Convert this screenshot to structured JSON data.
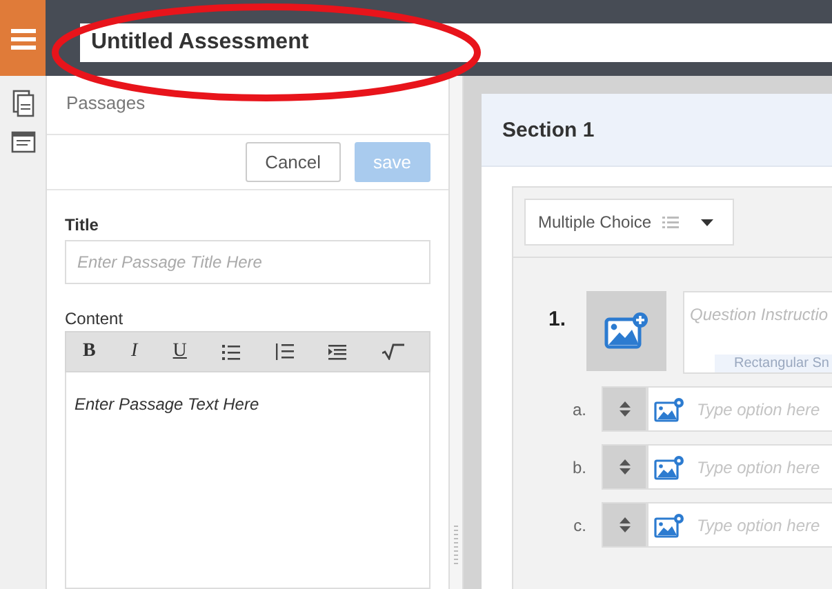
{
  "header": {
    "title": "Untitled Assessment"
  },
  "passages_panel": {
    "heading": "Passages",
    "buttons": [
      {
        "label": "Cancel",
        "disabled": false
      },
      {
        "label": "save",
        "disabled": true
      }
    ],
    "title_field": {
      "label": "Title",
      "placeholder": "Enter Passage Title Here"
    },
    "content_field": {
      "label": "Content",
      "toolbar": [
        {
          "kind": "bold",
          "label": "B"
        },
        {
          "kind": "italic",
          "label": "I"
        },
        {
          "kind": "underline",
          "label": "U"
        },
        {
          "kind": "bullets"
        },
        {
          "kind": "numbers"
        },
        {
          "kind": "indent"
        },
        {
          "kind": "sqrt"
        }
      ],
      "placeholder": "Enter Passage Text Here"
    }
  },
  "section": {
    "title": "Section 1",
    "question": {
      "type_dropdown": "Multiple Choice",
      "number": "1.",
      "instructions_placeholder": "Question Instructio",
      "hint": "Rectangular Sn",
      "options": [
        {
          "letter": "a.",
          "placeholder": "Type option here"
        },
        {
          "letter": "b.",
          "placeholder": "Type option here"
        },
        {
          "letter": "c.",
          "placeholder": "Type option here"
        }
      ]
    }
  }
}
